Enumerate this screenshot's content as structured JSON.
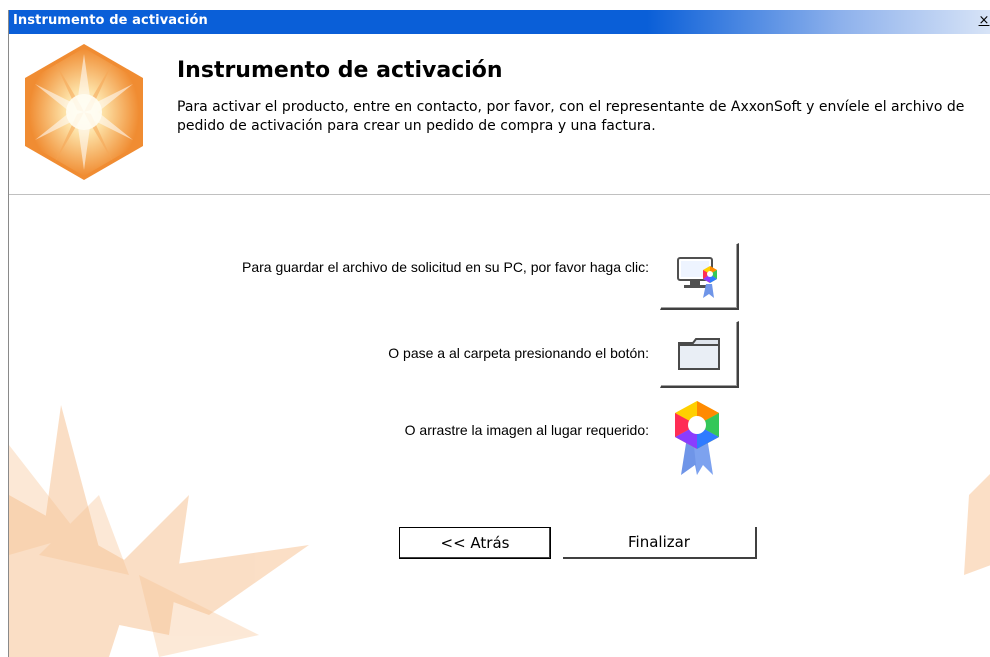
{
  "window": {
    "title": "Instrumento de activación",
    "close_glyph": "×"
  },
  "header": {
    "title": "Instrumento de activación",
    "description": "Para activar el producto, entre en contacto, por favor, con el representante de AxxonSoft y envíele el archivo de pedido de activación para crear un pedido de compra y una factura.",
    "logo_icon": "axxon-star-logo-icon"
  },
  "actions": {
    "save_label": "Para guardar el archivo de solicitud en su PC, por favor haga clic:",
    "save_icon": "save-request-icon",
    "folder_label": "O pase a al carpeta presionando el botón:",
    "folder_icon": "folder-icon",
    "drag_label": "O arrastre la imagen al lugar requerido:",
    "drag_icon": "activation-ribbon-icon"
  },
  "footer": {
    "back_label": "<< Atrás",
    "finish_label": "Finalizar"
  },
  "colors": {
    "titlebar": "#0a5fd8",
    "accent_orange": "#f3a35c"
  }
}
